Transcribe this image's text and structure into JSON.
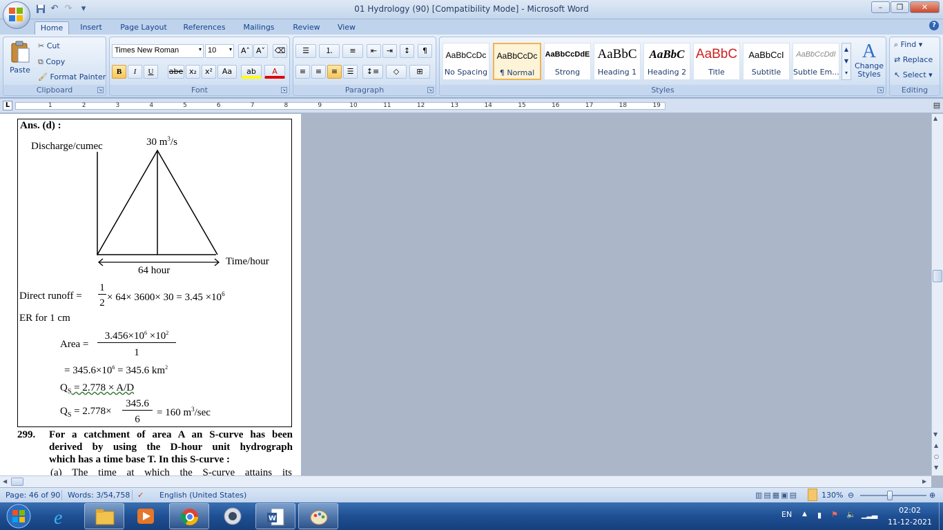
{
  "window": {
    "title": "01 Hydrology (90) [Compatibility Mode] - Microsoft Word",
    "minimize": "–",
    "restore": "❐",
    "close": "✕"
  },
  "qat": {
    "save_icon": "save-icon",
    "undo_icon": "undo-icon",
    "redo_icon": "redo-icon",
    "customize": "▾"
  },
  "tabs": [
    "Home",
    "Insert",
    "Page Layout",
    "References",
    "Mailings",
    "Review",
    "View"
  ],
  "ribbon": {
    "clipboard": {
      "label": "Clipboard",
      "paste": "Paste",
      "cut": "Cut",
      "copy": "Copy",
      "format_painter": "Format Painter"
    },
    "font": {
      "label": "Font",
      "family": "Times New Roman",
      "size": "10",
      "grow": "A˄",
      "shrink": "A˅",
      "bold": "B",
      "italic": "I",
      "underline": "U",
      "strike": "abe",
      "subscript": "x₂",
      "superscript": "x²",
      "change_case": "Aa",
      "highlight": "ab",
      "font_color": "A"
    },
    "paragraph": {
      "label": "Paragraph",
      "show_marks": "¶"
    },
    "styles": {
      "label": "Styles",
      "items": [
        {
          "preview": "AaBbCcDc",
          "name": "No Spacing"
        },
        {
          "preview": "AaBbCcDc",
          "name": "¶ Normal"
        },
        {
          "preview": "AaBbCcDdE",
          "name": "Strong"
        },
        {
          "preview": "AaBbC",
          "name": "Heading 1"
        },
        {
          "preview": "AaBbC",
          "name": "Heading 2"
        },
        {
          "preview": "AaBbC",
          "name": "Title"
        },
        {
          "preview": "AaBbCcI",
          "name": "Subtitle"
        },
        {
          "preview": "AaBbCcDdI",
          "name": "Subtle Em..."
        }
      ],
      "change_styles": "Change Styles"
    },
    "editing": {
      "label": "Editing",
      "find": "Find",
      "replace": "Replace",
      "select": "Select"
    }
  },
  "ruler": {
    "tab_selector": "L",
    "numbers": [
      "1",
      "2",
      "3",
      "4",
      "5",
      "6",
      "7",
      "8",
      "9",
      "10",
      "11",
      "12",
      "13",
      "14",
      "15",
      "16",
      "17",
      "18",
      "19"
    ]
  },
  "document": {
    "ans": "Ans. (d) :",
    "y_label": "Discharge/cumec",
    "peak_label": "30 m",
    "peak_unit_sup": "3",
    "peak_unit_tail": "/s",
    "base_label": "64 hour",
    "x_label": "Time/hour",
    "runoff_prefix": "Direct runoff =",
    "runoff_frac_num": "1",
    "runoff_frac_den": "2",
    "runoff_rest": "× 64× 3600× 30 = 3.45 ×10",
    "runoff_exp": "6",
    "er_line": "ER for 1 cm",
    "area_prefix": "Area =",
    "area_num_a": "3.456×10",
    "area_num_exp1": "6",
    "area_num_b": " ×10",
    "area_num_exp2": "2",
    "area_den": "1",
    "area_result_a": "= 345.6×10",
    "area_result_exp": "6",
    "area_result_b": " = 345.6 km",
    "area_result_exp2": "2",
    "qs1_q": "Q",
    "qs1_sub": "S",
    "qs1_rest": " =  2.778 × A/D",
    "qs2_q": "Q",
    "qs2_sub": "S",
    "qs2_mid": " =  2.778×",
    "qs2_num": "345.6",
    "qs2_den": "6",
    "qs2_tail": "= 160 m",
    "qs2_exp": "3",
    "qs2_end": "/sec",
    "q_number": "299.",
    "q_line1": "For a catchment of area A an S-curve has been",
    "q_line2": "derived by using the D-hour unit hydrograph",
    "q_line3": "which has a time base T. In this S-curve :",
    "q_option_a": "(a) The time at which the S-curve attains its"
  },
  "status": {
    "page": "Page: 46 of 90",
    "words": "Words: 3/54,758",
    "language": "English (United States)",
    "zoom": "130%",
    "zoom_level": 0.45
  },
  "taskbar": {
    "start_icon": "windows-start-icon",
    "apps": [
      "internet-explorer-icon",
      "file-explorer-icon",
      "media-player-icon",
      "chrome-icon",
      "itunes-icon",
      "word-icon",
      "paint-icon"
    ],
    "lang": "EN",
    "time": "02:02",
    "date": "11-12-2021"
  },
  "colors": {
    "ribbon_bg": "#cfdff2",
    "taskbar_bg": "#1e4f93",
    "selected_style": "#f2b34e"
  }
}
